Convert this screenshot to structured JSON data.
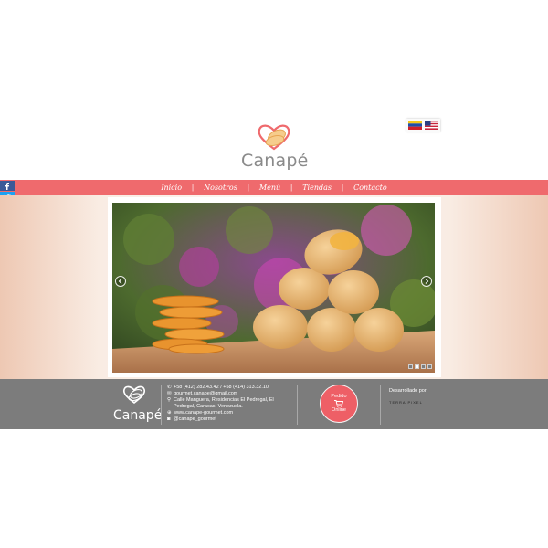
{
  "header": {
    "logo_text": "Canapé",
    "languages": [
      {
        "name": "venezuela-flag"
      },
      {
        "name": "usa-flag"
      }
    ]
  },
  "nav": {
    "items": [
      "Inicio",
      "Nosotros",
      "Menú",
      "Tiendas",
      "Contacto"
    ],
    "separator": "|"
  },
  "social": {
    "icons": [
      "facebook-icon",
      "twitter-icon",
      "instagram-icon",
      "mail-icon"
    ],
    "colors": [
      "#3b5998",
      "#1da1f2",
      "#8a5a44",
      "#7a7a7a"
    ]
  },
  "slider": {
    "total_slides": 4,
    "active_slide": 2
  },
  "footer": {
    "logo_text": "Canapé",
    "phone": "+58 (412) 282.43.42 / +58 (414) 313.32.10",
    "email": "gourmet.canape@gmail.com",
    "address_line1": "Calle Manguera, Residencias El Pedregal, El",
    "address_line2": "Pedregal, Caracas, Venezuela.",
    "website": "www.canape-gourmet.com",
    "instagram": "@canape_gourmet",
    "order_line1": "Pedido",
    "order_line2": "Online",
    "developed_by": "Desarrollado por:",
    "developer_brand": "TERRA PIXEL"
  },
  "colors": {
    "accent": "#ef6a6d",
    "footer_bg": "#7c7c7c"
  }
}
